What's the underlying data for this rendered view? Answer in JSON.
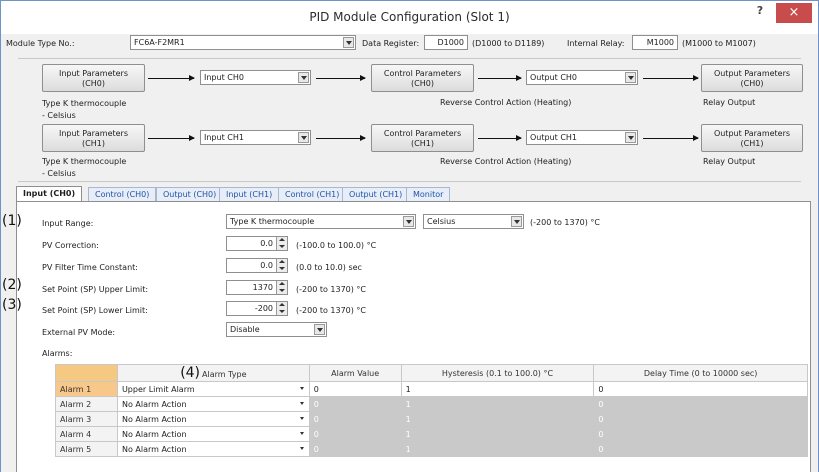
{
  "window": {
    "title": "PID Module Configuration (Slot 1)",
    "help": "?",
    "close": "×"
  },
  "header": {
    "module_type_label": "Module Type No.:",
    "module_type_value": "FC6A-F2MR1",
    "data_register_label": "Data Register:",
    "data_register_value": "D1000",
    "data_register_range": "(D1000 to D1189)",
    "internal_relay_label": "Internal Relay:",
    "internal_relay_value": "M1000",
    "internal_relay_range": "(M1000 to M1007)"
  },
  "flow": [
    {
      "input_params_btn": "Input Parameters\n(CH0)",
      "input_select": "Input CH0",
      "control_params_btn": "Control Parameters\n(CH0)",
      "output_select": "Output CH0",
      "output_params_btn": "Output Parameters\n(CH0)",
      "input_desc": "Type K thermocouple\n- Celsius",
      "control_desc": "Reverse Control Action (Heating)",
      "output_desc": "Relay Output"
    },
    {
      "input_params_btn": "Input Parameters\n(CH1)",
      "input_select": "Input CH1",
      "control_params_btn": "Control Parameters\n(CH1)",
      "output_select": "Output CH1",
      "output_params_btn": "Output Parameters\n(CH1)",
      "input_desc": "Type K thermocouple\n- Celsius",
      "control_desc": "Reverse Control Action (Heating)",
      "output_desc": "Relay Output"
    }
  ],
  "tabs": [
    "Input (CH0)",
    "Control (CH0)",
    "Output (CH0)",
    "Input (CH1)",
    "Control (CH1)",
    "Output (CH1)",
    "Monitor"
  ],
  "form": {
    "input_range_label": "Input Range:",
    "input_range_value": "Type K thermocouple",
    "unit_value": "Celsius",
    "input_range_hint": "(-200 to 1370) °C",
    "pv_correction_label": "PV Correction:",
    "pv_correction_value": "0.0",
    "pv_correction_hint": "(-100.0 to 100.0) °C",
    "pv_filter_label": "PV Filter Time Constant:",
    "pv_filter_value": "0.0",
    "pv_filter_hint": "(0.0 to 10.0) sec",
    "sp_upper_label": "Set Point (SP) Upper Limit:",
    "sp_upper_value": "1370",
    "sp_upper_hint": "(-200 to 1370) °C",
    "sp_lower_label": "Set Point (SP) Lower Limit:",
    "sp_lower_value": "-200",
    "sp_lower_hint": "(-200 to 1370) °C",
    "ext_pv_label": "External PV Mode:",
    "ext_pv_value": "Disable",
    "alarms_label": "Alarms:"
  },
  "markers": [
    "(1)",
    "(2)",
    "(3)",
    "(4)"
  ],
  "alarms": {
    "headers": [
      "Alarm Type",
      "Alarm Value",
      "Hysteresis (0.1 to 100.0) °C",
      "Delay Time (0 to 10000 sec)"
    ],
    "rows": [
      {
        "name": "Alarm 1",
        "type": "Upper Limit Alarm",
        "value": "0",
        "hysteresis": "1",
        "delay": "0"
      },
      {
        "name": "Alarm 2",
        "type": "No Alarm Action",
        "value": "0",
        "hysteresis": "1",
        "delay": "0"
      },
      {
        "name": "Alarm 3",
        "type": "No Alarm Action",
        "value": "0",
        "hysteresis": "1",
        "delay": "0"
      },
      {
        "name": "Alarm 4",
        "type": "No Alarm Action",
        "value": "0",
        "hysteresis": "1",
        "delay": "0"
      },
      {
        "name": "Alarm 5",
        "type": "No Alarm Action",
        "value": "0",
        "hysteresis": "1",
        "delay": "0"
      }
    ]
  }
}
